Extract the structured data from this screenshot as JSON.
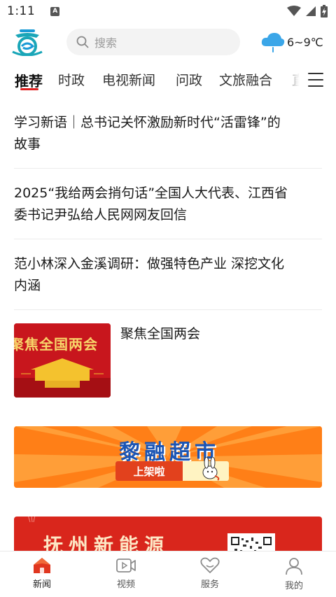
{
  "status_bar": {
    "time": "1:11",
    "notification_icon": "A"
  },
  "header": {
    "search_placeholder": "搜索",
    "weather": {
      "temperature": "6~9℃",
      "icon": "cloud-rain-icon"
    }
  },
  "tabs": [
    "推荐",
    "时政",
    "电视新闻",
    "问政",
    "文旅融合",
    "直"
  ],
  "active_tab": "推荐",
  "news": [
    {
      "title_line1": "学习新语｜总书记关怀激励新时代“活雷锋”的",
      "title_line2": "故事"
    },
    {
      "title_line1": "2025“我给两会捎句话”全国人大代表、江西省",
      "title_line2": "委书记尹弘给人民网网友回信"
    },
    {
      "title_line1": "范小林深入金溪调研：做强特色产业 深挖文化",
      "title_line2": "内涵"
    },
    {
      "title": "聚焦全国两会",
      "thumbnail_text": "聚焦全国两会"
    }
  ],
  "banners": {
    "market": {
      "title": "黎融超市",
      "subtitle": "上架啦"
    },
    "energy": {
      "title": "抚州新能源"
    }
  },
  "bottom_nav": [
    {
      "label": "新闻",
      "icon": "home-icon",
      "active": true
    },
    {
      "label": "视频",
      "icon": "video-icon",
      "active": false
    },
    {
      "label": "服务",
      "icon": "heart-icon",
      "active": false
    },
    {
      "label": "我的",
      "icon": "user-icon",
      "active": false
    }
  ],
  "colors": {
    "accent": "#e02020",
    "banner_orange": "#ff8a1c",
    "banner_red": "#d9261c",
    "weather_blue": "#3ba6e8"
  }
}
